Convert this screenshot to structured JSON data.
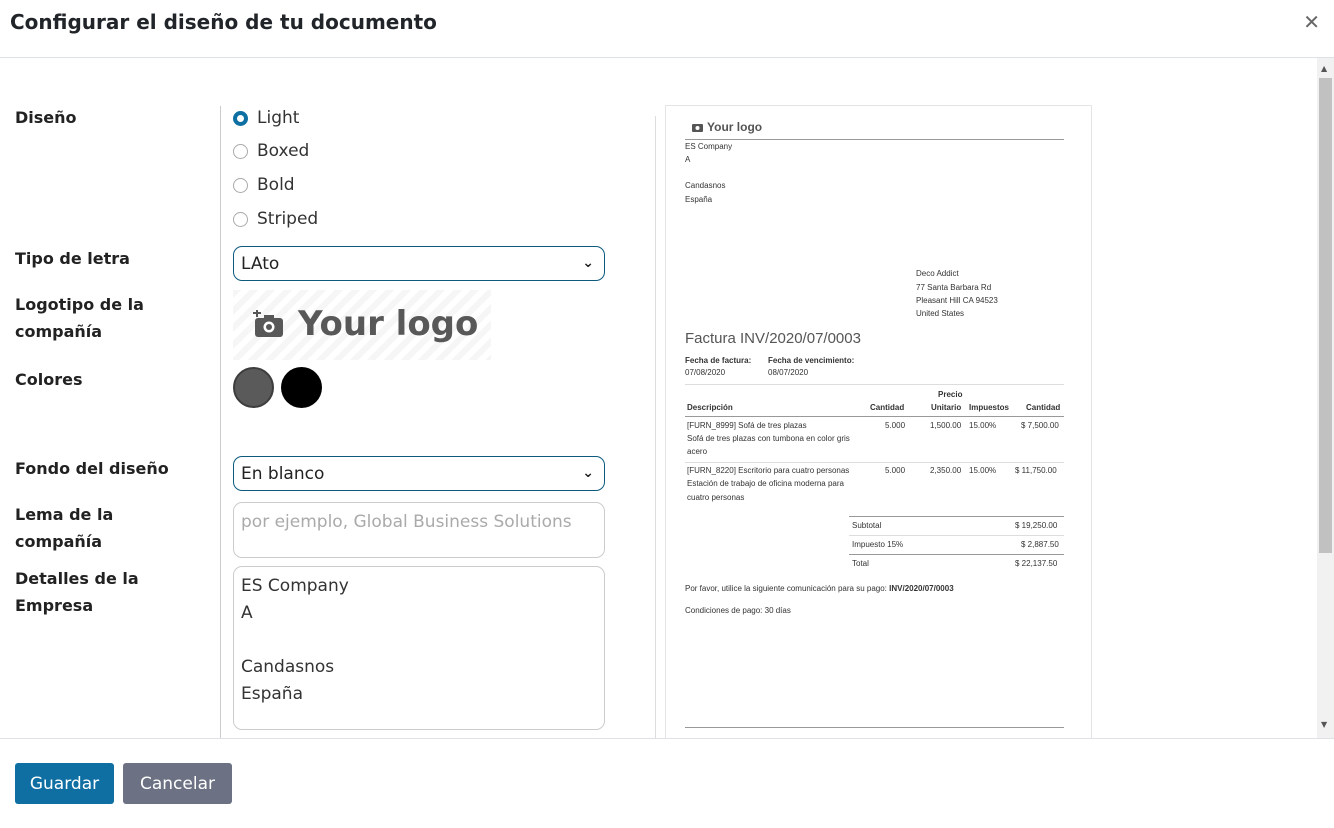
{
  "dialog": {
    "title": "Configurar el diseño de tu documento"
  },
  "labels": {
    "layout": "Diseño",
    "font": "Tipo de letra",
    "logo_1": "Logotipo de la",
    "logo_2": "compañía",
    "colors": "Colores",
    "background": "Fondo del diseño",
    "tagline_1": "Lema de la",
    "tagline_2": "compañía",
    "details_1": "Detalles de la",
    "details_2": "Empresa"
  },
  "layouts": [
    "Light",
    "Boxed",
    "Bold",
    "Striped"
  ],
  "selected_layout": "Light",
  "font": {
    "value": "LAto"
  },
  "logo": {
    "text": "Your logo"
  },
  "colors": {
    "primary": "#5a5a5a",
    "secondary": "#000000"
  },
  "background": {
    "value": "En blanco"
  },
  "tagline": {
    "placeholder": "por ejemplo, Global Business Solutions"
  },
  "company_details": {
    "lines": [
      "ES Company",
      "A",
      "",
      "Candasnos",
      "España"
    ]
  },
  "preview": {
    "logo": "Your logo",
    "company": [
      "ES Company",
      "A",
      "",
      "Candasnos",
      "España"
    ],
    "customer": [
      "Deco Addict",
      "77 Santa Barbara Rd",
      "Pleasant Hill CA 94523",
      "United States"
    ],
    "invoice_title": "Factura INV/2020/07/0003",
    "invoice_date_label": "Fecha de factura:",
    "invoice_date": "07/08/2020",
    "due_date_label": "Fecha de vencimiento:",
    "due_date": "08/07/2020",
    "columns": {
      "description": "Descripción",
      "quantity": "Cantidad",
      "unit_price_1": "Precio",
      "unit_price_2": "Unitario",
      "taxes": "Impuestos",
      "amount": "Cantidad"
    },
    "lines": [
      {
        "desc": [
          "[FURN_8999] Sofá de tres plazas",
          "Sofá de tres plazas con tumbona en color gris",
          "acero"
        ],
        "qty": "5.000",
        "price": "1,500.00",
        "tax": "15.00%",
        "amount": "$ 7,500.00"
      },
      {
        "desc": [
          "[FURN_8220] Escritorio para cuatro personas",
          "Estación de trabajo de oficina moderna para",
          "cuatro personas"
        ],
        "qty": "5.000",
        "price": "2,350.00",
        "tax": "15.00%",
        "amount": "$ 11,750.00"
      }
    ],
    "subtotal_label": "Subtotal",
    "subtotal": "$ 19,250.00",
    "tax_label": "Impuesto 15%",
    "tax": "$ 2,887.50",
    "total_label": "Total",
    "total": "$ 22,137.50",
    "payment_ref_text": "Por favor, utilice la siguiente comunicación para su pago:",
    "payment_ref": "INV/2020/07/0003",
    "payment_terms": "Condiciones de pago: 30 días"
  },
  "buttons": {
    "save": "Guardar",
    "cancel": "Cancelar"
  },
  "theme": {
    "primary": "#0f6fa3",
    "secondary": "#6c7283"
  }
}
